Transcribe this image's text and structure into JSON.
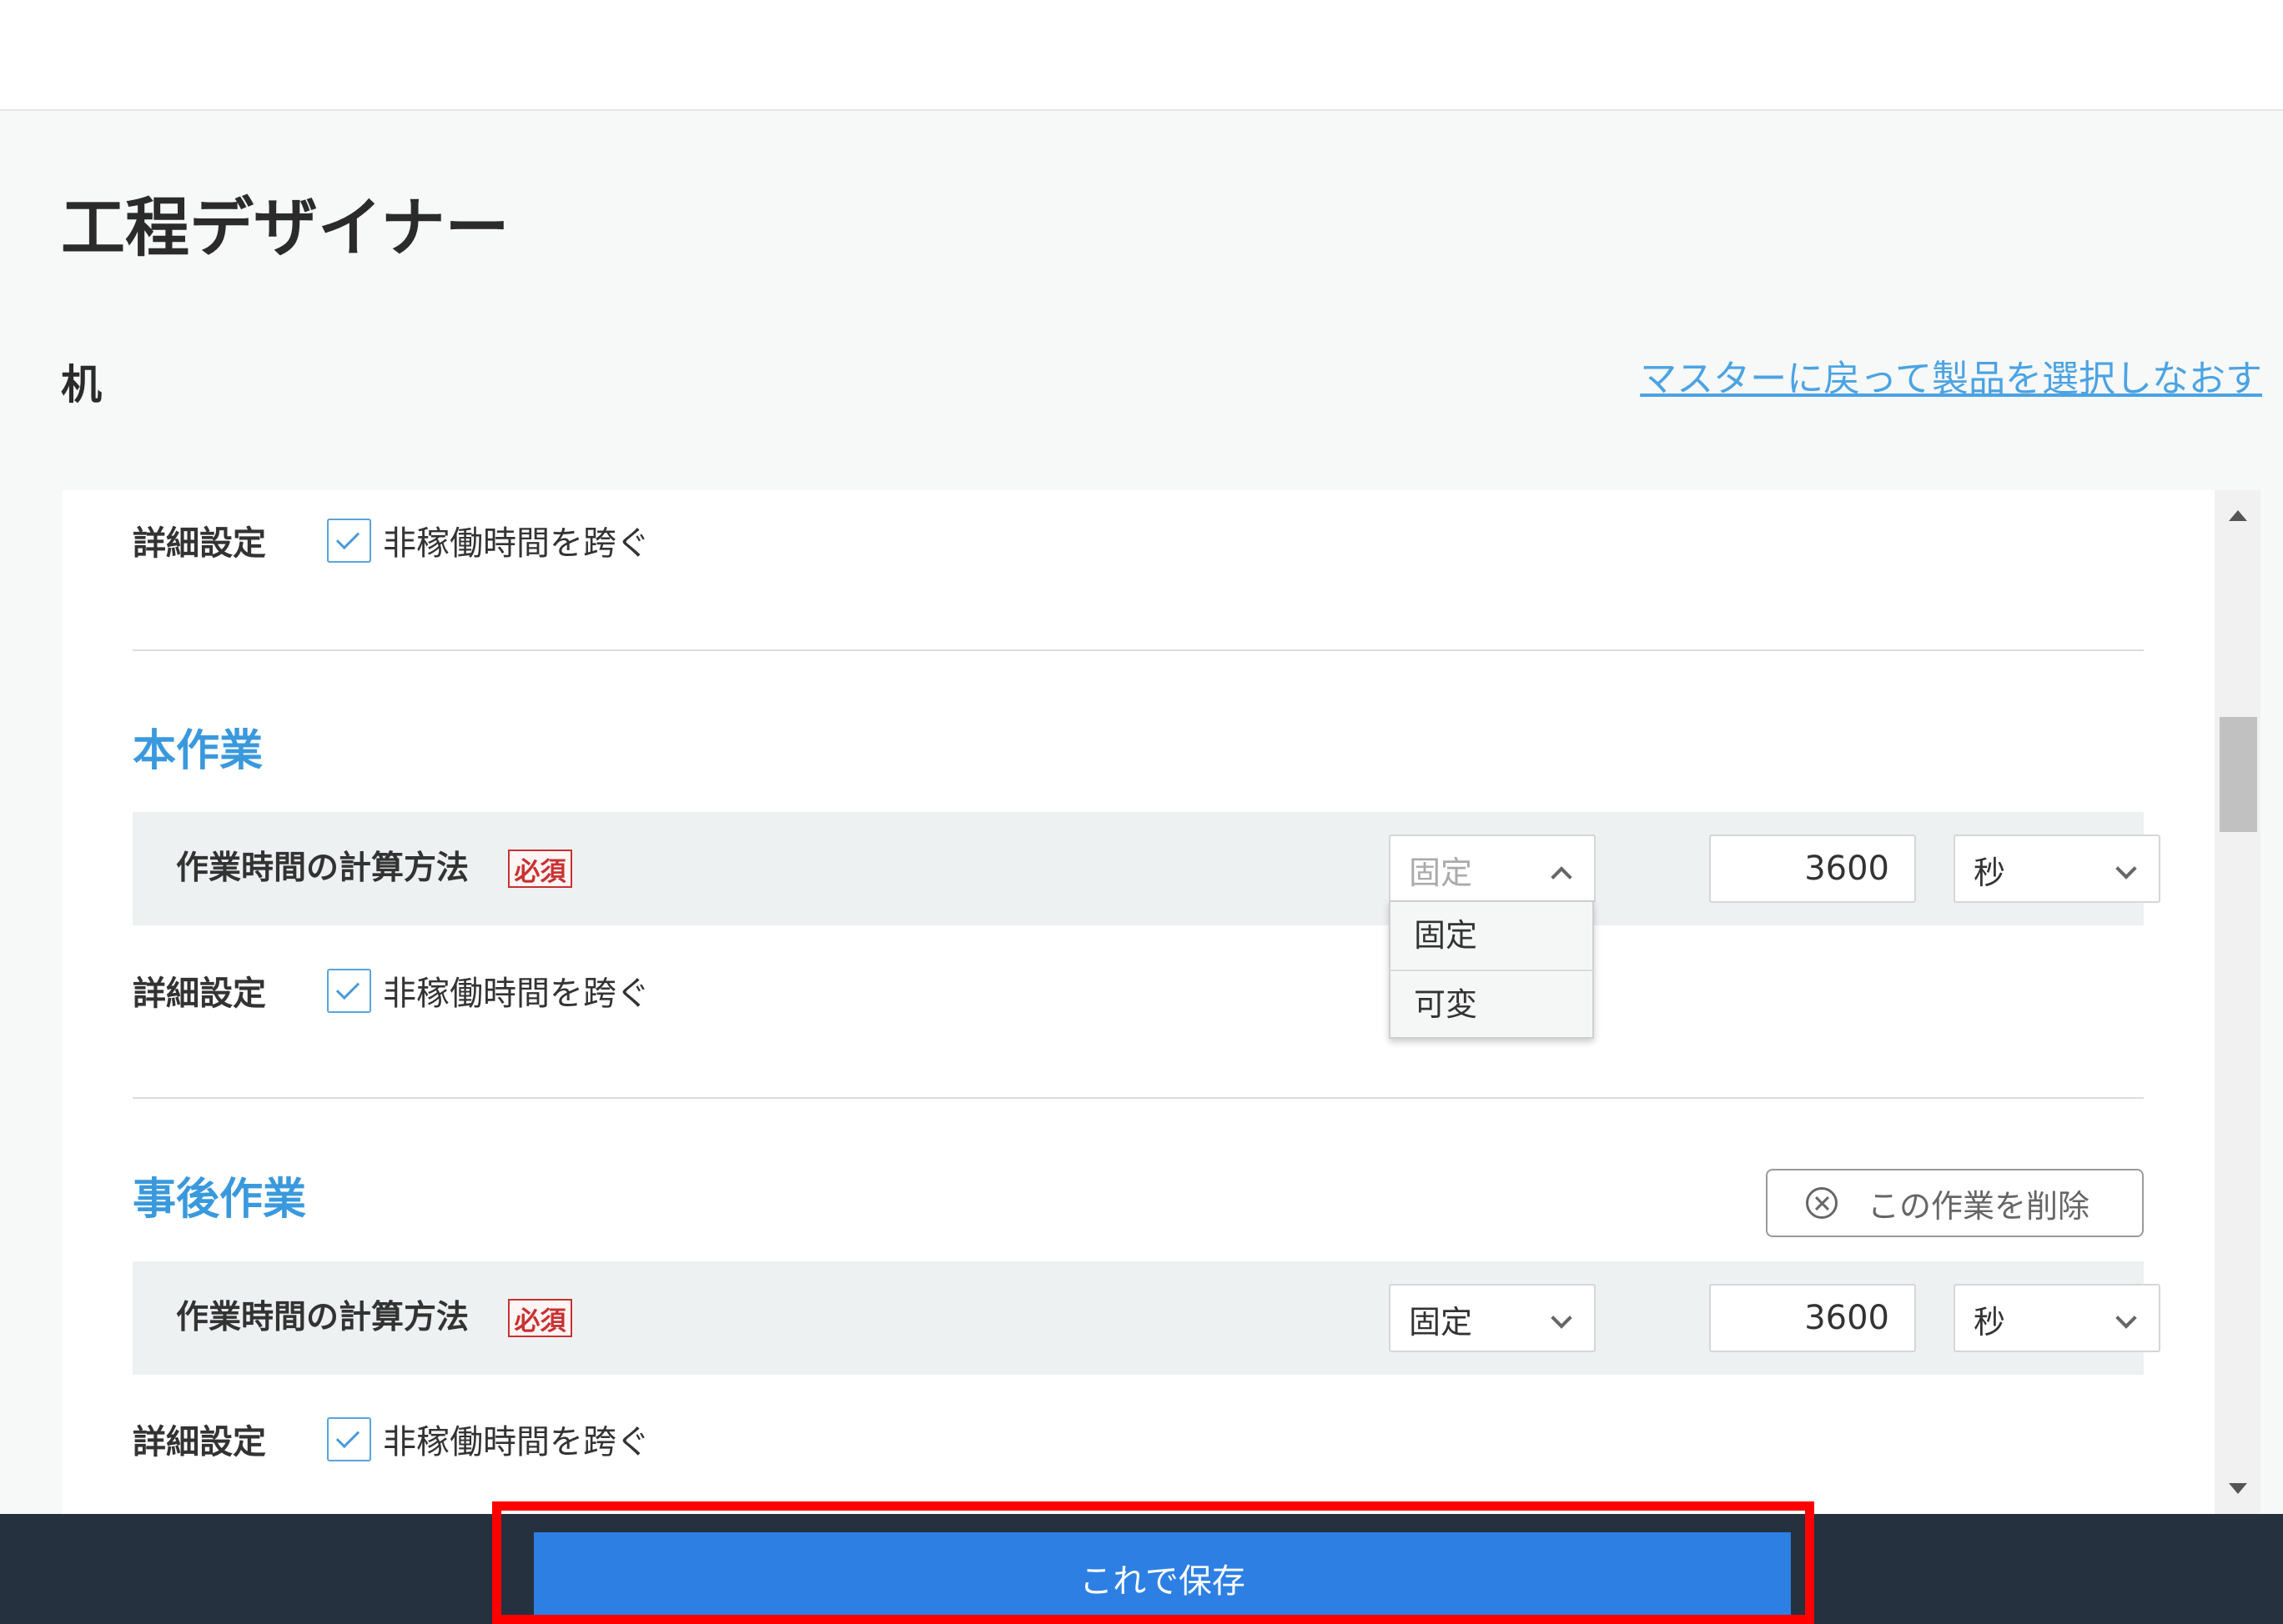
{
  "page": {
    "title": "工程デザイナー",
    "product_name": "机",
    "back_link": "マスターに戻って製品を選択しなおす"
  },
  "sections": [
    {
      "detail_label": "詳細設定",
      "checkbox_label": "非稼働時間を跨ぐ",
      "checked": true
    },
    {
      "title": "本作業",
      "calc_label": "作業時間の計算方法",
      "required": "必須",
      "method": "固定",
      "method_open": true,
      "method_options": [
        "固定",
        "可変"
      ],
      "time_value": "3600",
      "unit": "秒",
      "detail_label": "詳細設定",
      "checkbox_label": "非稼働時間を跨ぐ",
      "checked": true
    },
    {
      "title": "事後作業",
      "delete_label": "この作業を削除",
      "calc_label": "作業時間の計算方法",
      "required": "必須",
      "method": "固定",
      "time_value": "3600",
      "unit": "秒",
      "detail_label": "詳細設定",
      "checkbox_label": "非稼働時間を跨ぐ",
      "checked": true
    }
  ],
  "footer": {
    "save_label": "これで保存"
  },
  "colors": {
    "accent": "#3a99dd",
    "save_button": "#2d7fe3",
    "footer_bg": "#25313f",
    "required": "#c83232",
    "highlight": "#ff0000"
  },
  "icons": [
    "check-icon",
    "chevron-down-icon",
    "chevron-up-icon",
    "circle-x-icon",
    "scroll-up-icon",
    "scroll-down-icon"
  ]
}
